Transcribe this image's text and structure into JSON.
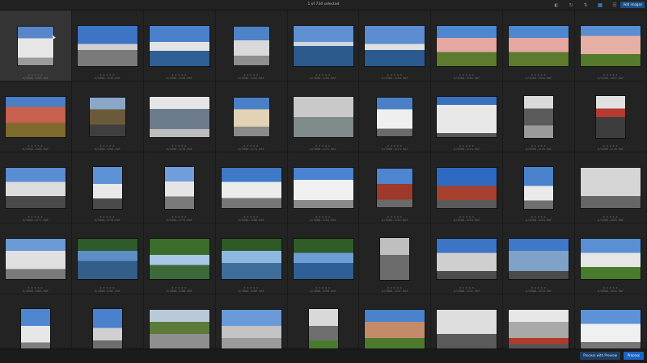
{
  "header": {
    "title": "1 of 734 selected",
    "icons": [
      "filter-icon",
      "rotate-icon",
      "sort-icon",
      "grid-icon",
      "list-icon"
    ],
    "add_images_label": "Add images"
  },
  "footer": {
    "status": "",
    "secondary_button": "Process with Preview",
    "primary_button": "Process"
  },
  "palette": {
    "sky": "#3f79c8",
    "water": "#2f5f95",
    "building": "#d8d8d8",
    "foliage": "#4d7a2f",
    "accent_red": "#c0392b",
    "street": "#8f8f8f"
  },
  "thumbnails": [
    {
      "file": "d/2000-1258.RAF",
      "orient": "square",
      "style": "g1"
    },
    {
      "file": "d/2000-1259.RAF",
      "orient": "landscape",
      "style": "g2"
    },
    {
      "file": "d/2000-1260.RAF",
      "orient": "landscape",
      "style": "g3"
    },
    {
      "file": "d/2000-1262.RAF",
      "orient": "square",
      "style": "g4"
    },
    {
      "file": "d/2000-1263.RAF",
      "orient": "landscape",
      "style": "g5"
    },
    {
      "file": "d/2000-1264.RAF",
      "orient": "landscape",
      "style": "g6"
    },
    {
      "file": "d/2000-1265.RAF",
      "orient": "landscape",
      "style": "g7"
    },
    {
      "file": "d/2000-1266.RAF",
      "orient": "landscape",
      "style": "g7"
    },
    {
      "file": "d/2000-1267.RAF",
      "orient": "landscape",
      "style": "g8"
    },
    {
      "file": "d/2000-1268.RAF",
      "orient": "landscape",
      "style": "g9"
    },
    {
      "file": "d/2000-1269.RAF",
      "orient": "square",
      "style": "g10"
    },
    {
      "file": "d/2000-1270.RAF",
      "orient": "landscape",
      "style": "g11"
    },
    {
      "file": "d/2000-1271.RAF",
      "orient": "square",
      "style": "g12"
    },
    {
      "file": "d/2000-1272.RAF",
      "orient": "landscape",
      "style": "g13"
    },
    {
      "file": "d/2000-1273.RAF",
      "orient": "square",
      "style": "g14"
    },
    {
      "file": "d/2000-1274.RAF",
      "orient": "landscape",
      "style": "g15"
    },
    {
      "file": "d/2000-1275.RAF",
      "orient": "portrait",
      "style": "g16"
    },
    {
      "file": "d/2000-1276.RAF",
      "orient": "portrait",
      "style": "g17"
    },
    {
      "file": "d/2000-1277.RAF",
      "orient": "landscape",
      "style": "g18"
    },
    {
      "file": "d/2000-1278.RAF",
      "orient": "portrait",
      "style": "g19"
    },
    {
      "file": "d/2000-1279.RAF",
      "orient": "portrait",
      "style": "g20"
    },
    {
      "file": "d/2000-1280.RAF",
      "orient": "landscape",
      "style": "g21"
    },
    {
      "file": "d/2000-1281.RAF",
      "orient": "landscape",
      "style": "g22"
    },
    {
      "file": "d/2000-1282.RAF",
      "orient": "square",
      "style": "g23"
    },
    {
      "file": "d/2000-1283.RAF",
      "orient": "landscape",
      "style": "g24"
    },
    {
      "file": "d/2000-1284.RAF",
      "orient": "portrait",
      "style": "g25"
    },
    {
      "file": "d/2000-1285.RAF",
      "orient": "landscape",
      "style": "g26"
    },
    {
      "file": "d/2000-1286.RAF",
      "orient": "landscape",
      "style": "g27"
    },
    {
      "file": "d/2000-1287.RAF",
      "orient": "landscape",
      "style": "g28"
    },
    {
      "file": "d/2000-1288.RAF",
      "orient": "landscape",
      "style": "g29"
    },
    {
      "file": "d/2000-1289.RAF",
      "orient": "landscape",
      "style": "g30"
    },
    {
      "file": "d/2000-1290.RAF",
      "orient": "landscape",
      "style": "g31"
    },
    {
      "file": "d/2000-1291.RAF",
      "orient": "portrait",
      "style": "g32"
    },
    {
      "file": "d/2000-1292.RAF",
      "orient": "landscape",
      "style": "g33"
    },
    {
      "file": "d/2000-1293.RAF",
      "orient": "landscape",
      "style": "g34"
    },
    {
      "file": "d/2000-1294.RAF",
      "orient": "landscape",
      "style": "g35"
    },
    {
      "file": "d/2000-1295.RAF",
      "orient": "portrait",
      "style": "g36"
    },
    {
      "file": "d/2000-1296.RAF",
      "orient": "portrait",
      "style": "g37"
    },
    {
      "file": "d/2000-1297.RAF",
      "orient": "landscape",
      "style": "g38"
    },
    {
      "file": "d/2000-1298.RAF",
      "orient": "landscape",
      "style": "g39"
    },
    {
      "file": "d/2000-1299.RAF",
      "orient": "portrait",
      "style": "g40"
    },
    {
      "file": "d/2000-1300.RAF",
      "orient": "landscape",
      "style": "g41"
    },
    {
      "file": "d/2000-1301.RAF",
      "orient": "landscape",
      "style": "g42"
    },
    {
      "file": "d/2000-1302.RAF",
      "orient": "landscape",
      "style": "g43"
    },
    {
      "file": "d/2000-1303.RAF",
      "orient": "landscape",
      "style": "g44"
    }
  ]
}
